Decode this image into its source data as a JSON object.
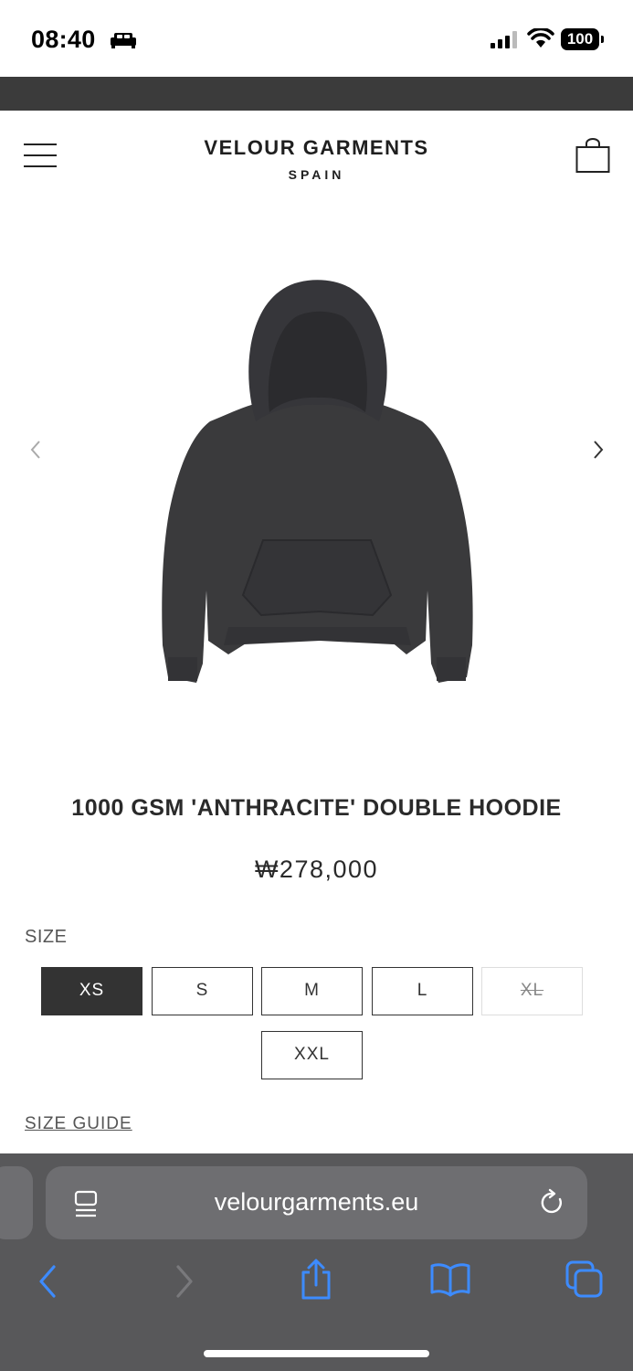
{
  "status": {
    "time": "08:40",
    "battery": "100"
  },
  "header": {
    "brand_name": "VELOUR GARMENTS",
    "brand_sub": "SPAIN"
  },
  "product": {
    "title": "1000 GSM 'ANTHRACITE' DOUBLE HOODIE",
    "price": "₩278,000",
    "image_color": "#3a3a3c"
  },
  "sizes": {
    "label": "SIZE",
    "options": [
      "XS",
      "S",
      "M",
      "L",
      "XL",
      "XXL"
    ],
    "selected": "XS",
    "sold_out": [
      "XL"
    ],
    "guide_label": "SIZE GUIDE"
  },
  "browser": {
    "url": "velourgarments.eu",
    "accent": "#3d8bff"
  }
}
